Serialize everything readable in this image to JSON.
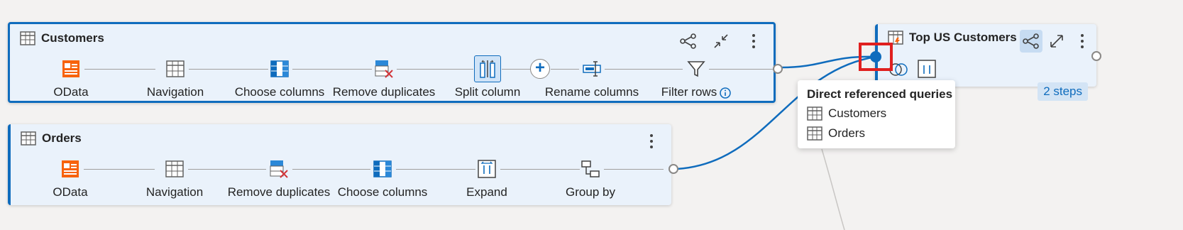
{
  "queries": {
    "customers": {
      "title": "Customers",
      "steps": [
        "OData",
        "Navigation",
        "Choose columns",
        "Remove duplicates",
        "Split column",
        "Rename columns",
        "Filter rows"
      ],
      "selected_step": "Split column"
    },
    "orders": {
      "title": "Orders",
      "steps": [
        "OData",
        "Navigation",
        "Remove duplicates",
        "Choose columns",
        "Expand",
        "Group by"
      ]
    },
    "top_us": {
      "title": "Top US Customers",
      "steps_badge": "2 steps"
    }
  },
  "tooltip": {
    "title": "Direct referenced queries",
    "items": [
      "Customers",
      "Orders"
    ]
  },
  "colors": {
    "accent": "#0f6cbd",
    "odata_orange": "#f7630c",
    "highlight_red": "#e0201f",
    "card_bg": "#eaf2fb"
  },
  "icons": {
    "odata": "odata-icon",
    "navigation": "table-icon",
    "choose_columns": "choose-columns-icon",
    "remove_duplicates": "remove-duplicates-icon",
    "split_column": "split-column-icon",
    "rename_columns": "rename-columns-icon",
    "filter_rows": "filter-icon",
    "expand": "expand-icon",
    "group_by": "group-by-icon"
  }
}
